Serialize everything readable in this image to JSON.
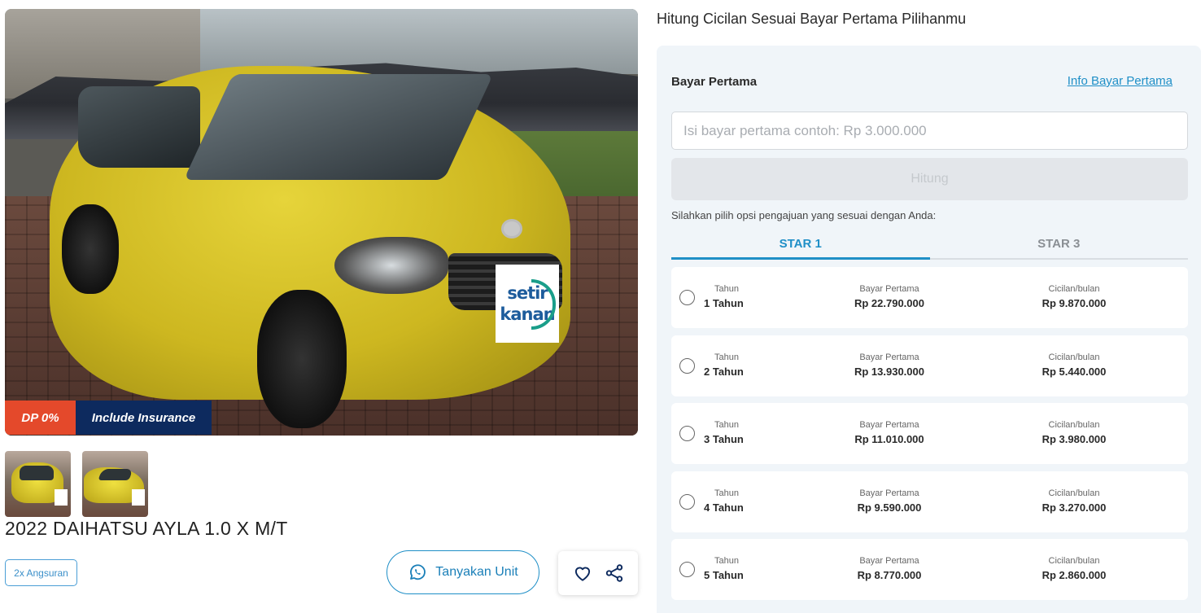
{
  "listing": {
    "badges": {
      "dp": "DP 0%",
      "insurance": "Include Insurance"
    },
    "watermark": {
      "line1": "setir",
      "line2": "kanan"
    },
    "title": "2022 DAIHATSU AYLA 1.0 X M/T",
    "angsuran_tag": "2x Angsuran",
    "ask_button": "Tanyakan Unit",
    "icons": [
      "whatsapp-icon",
      "heart-icon",
      "share-icon"
    ]
  },
  "installment": {
    "heading": "Hitung Cicilan Sesuai Bayar Pertama Pilihanmu",
    "bayar_pertama_label": "Bayar Pertama",
    "info_link": "Info Bayar Pertama",
    "input": {
      "value": "",
      "placeholder": "Isi bayar pertama contoh: Rp 3.000.000"
    },
    "hitung_button": "Hitung",
    "hint": "Silahkan pilih opsi pengajuan yang sesuai dengan Anda:",
    "tabs": [
      {
        "label": "STAR 1",
        "active": true
      },
      {
        "label": "STAR 3",
        "active": false
      }
    ],
    "column_labels": {
      "tenor": "Tahun",
      "dp": "Bayar Pertama",
      "monthly": "Cicilan/bulan"
    },
    "options": [
      {
        "tenor": "1 Tahun",
        "dp": "Rp 22.790.000",
        "monthly": "Rp 9.870.000"
      },
      {
        "tenor": "2 Tahun",
        "dp": "Rp 13.930.000",
        "monthly": "Rp 5.440.000"
      },
      {
        "tenor": "3 Tahun",
        "dp": "Rp 11.010.000",
        "monthly": "Rp 3.980.000"
      },
      {
        "tenor": "4 Tahun",
        "dp": "Rp 9.590.000",
        "monthly": "Rp 3.270.000"
      },
      {
        "tenor": "5 Tahun",
        "dp": "Rp 8.770.000",
        "monthly": "Rp 2.860.000"
      }
    ]
  },
  "colors": {
    "accent": "#1f8fc7",
    "dp_badge": "#e4492b",
    "insurance_badge": "#0d2a5e",
    "panel_bg": "#f0f5f9",
    "car": "#d4c224"
  }
}
